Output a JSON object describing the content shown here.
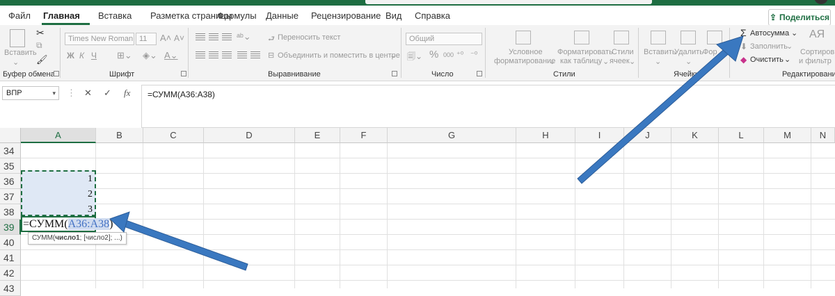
{
  "menu": {
    "tabs": [
      "Файл",
      "Главная",
      "Вставка",
      "Разметка страницы",
      "Формулы",
      "Данные",
      "Рецензирование",
      "Вид",
      "Справка"
    ],
    "active_tab": "Главная",
    "share_label": "Поделиться"
  },
  "ribbon": {
    "clipboard": {
      "paste_label": "Вставить",
      "group_label": "Буфер обмена"
    },
    "font": {
      "font_name": "Times New Roman",
      "font_size": "11",
      "bold": "Ж",
      "italic": "К",
      "underline": "Ч",
      "group_label": "Шрифт"
    },
    "alignment": {
      "wrap_text": "Переносить текст",
      "merge_center": "Объединить и поместить в центре",
      "group_label": "Выравнивание"
    },
    "number": {
      "format": "Общий",
      "percent": "%",
      "thousands": "000",
      "group_label": "Число"
    },
    "styles": {
      "conditional_1": "Условное",
      "conditional_2": "форматирование",
      "format_table_1": "Форматировать",
      "format_table_2": "как таблицу",
      "cell_styles_1": "Стили",
      "cell_styles_2": "ячеек",
      "group_label": "Стили"
    },
    "cells": {
      "insert": "Вставить",
      "delete": "Удалить",
      "format": "Фор",
      "group_label": "Ячейки"
    },
    "editing": {
      "autosum": "Автосумма",
      "fill": "Заполнить",
      "clear": "Очистить",
      "sort_1": "Сортиров",
      "sort_2": "и фильтр",
      "group_label": "Редактирование"
    }
  },
  "formula_bar": {
    "name_box": "ВПР",
    "cancel_symbol": "✕",
    "enter_symbol": "✓",
    "fx_symbol": "fx",
    "formula": "=СУММ(A36:A38)"
  },
  "sheet": {
    "columns": [
      "A",
      "B",
      "C",
      "D",
      "E",
      "F",
      "G",
      "H",
      "I",
      "J",
      "K",
      "L",
      "M",
      "N"
    ],
    "selected_column": "A",
    "rows": [
      "34",
      "35",
      "36",
      "37",
      "38",
      "39",
      "40",
      "41",
      "42",
      "43"
    ],
    "selected_row": "39",
    "values": {
      "A36": "1",
      "A37": "2",
      "A38": "3"
    },
    "edit_cell": {
      "prefix": "=СУММ(",
      "ref": "A36:A38",
      "suffix": ")"
    },
    "tooltip": {
      "func": "СУММ(",
      "arg1": "число1",
      "rest": "; [число2]; ...)"
    }
  },
  "colors": {
    "accent": "#1e6e42",
    "arrow": "#3a78c0",
    "range_fill": "#dfe8f5"
  }
}
